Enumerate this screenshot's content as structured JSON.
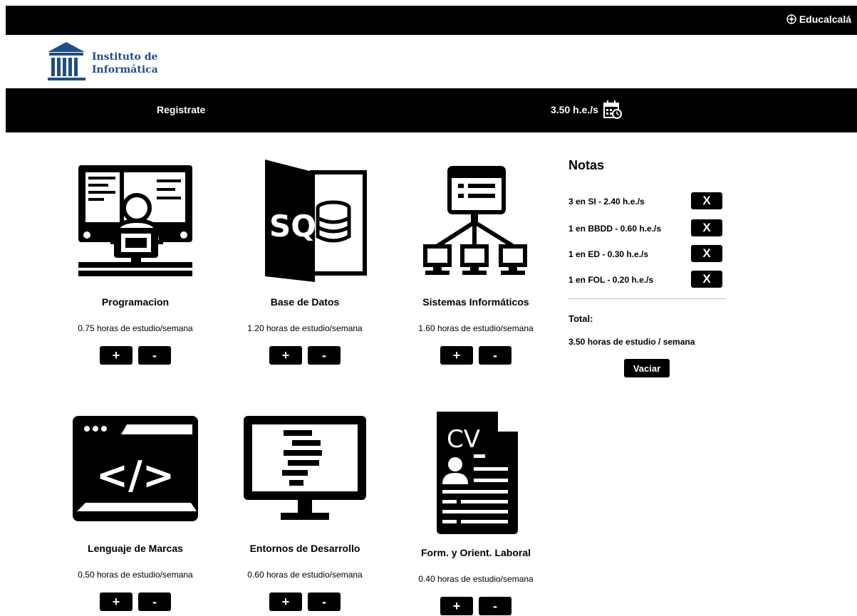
{
  "header": {
    "brand": "Educalcalá",
    "brand_icon": "gear-wheel-icon"
  },
  "logo": {
    "line1": "Instituto de",
    "line2": "Informática",
    "icon": "institution-building-icon",
    "color": "#1e4f86"
  },
  "nav": {
    "register_label": "Registrate",
    "hours_label": "3.50 h.e./s",
    "hours_icon": "calendar-clock-icon"
  },
  "courses": [
    {
      "title": "Programacion",
      "hours": "0.75 horas de estudio/semana",
      "plus": "+",
      "minus": "-",
      "icon": "programmer-computer-icon"
    },
    {
      "title": "Base de Datos",
      "hours": "1.20 horas de estudio/semana",
      "plus": "+",
      "minus": "-",
      "icon": "sql-database-icon",
      "art_text": "SQL"
    },
    {
      "title": "Sistemas Informáticos",
      "hours": "1.60 horas de estudio/semana",
      "plus": "+",
      "minus": "-",
      "icon": "network-computers-icon"
    },
    {
      "title": "Lenguaje de Marcas",
      "hours": "0.50 horas de estudio/semana",
      "plus": "+",
      "minus": "-",
      "icon": "code-window-icon",
      "art_text": "</>"
    },
    {
      "title": "Entornos de Desarrollo",
      "hours": "0.60 horas de estudio/semana",
      "plus": "+",
      "minus": "-",
      "icon": "monitor-code-icon"
    },
    {
      "title": "Form. y Orient. Laboral",
      "hours": "0.40 horas de estudio/semana",
      "plus": "+",
      "minus": "-",
      "icon": "cv-document-icon",
      "art_text": "CV"
    }
  ],
  "notas": {
    "title": "Notas",
    "items": [
      {
        "text": "3 en SI - 2.40 h.e./s",
        "remove": "X"
      },
      {
        "text": "1 en BBDD - 0.60 h.e./s",
        "remove": "X"
      },
      {
        "text": "1 en ED - 0.30 h.e./s",
        "remove": "X"
      },
      {
        "text": "1 en FOL - 0.20 h.e./s",
        "remove": "X"
      }
    ],
    "total_label": "Total:",
    "total_value": "3.50 horas de estudio / semana",
    "clear_label": "Vaciar"
  }
}
